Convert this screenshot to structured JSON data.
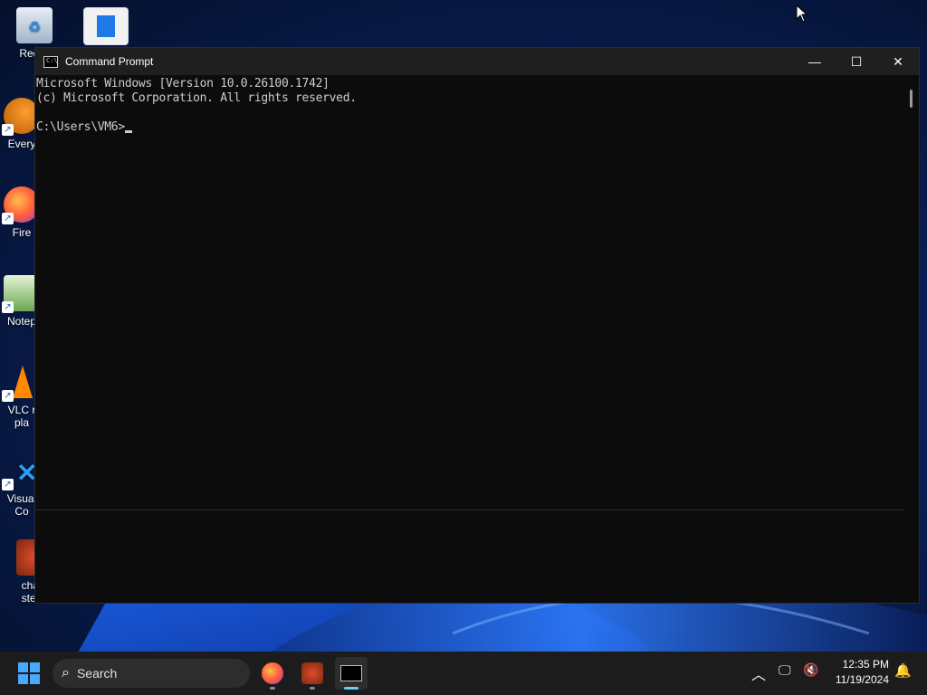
{
  "desktop": {
    "icons": [
      {
        "label": "Recyc",
        "icon": "recycle-bin-icon"
      },
      {
        "label": "",
        "icon": "window-app-icon"
      },
      {
        "label": "Every",
        "icon": "everything-search-icon"
      },
      {
        "label": "Fire",
        "icon": "firefox-icon"
      },
      {
        "label": "Notep",
        "icon": "notepad-icon"
      },
      {
        "label": "VLC r",
        "label2": "pla",
        "icon": "vlc-icon"
      },
      {
        "label": "Visual",
        "label2": "Co",
        "icon": "vscode-icon"
      },
      {
        "label": "charli",
        "label2": "steak",
        "icon": "game-icon"
      }
    ]
  },
  "window": {
    "title": "Command Prompt",
    "minimize": "—",
    "maximize": "☐",
    "close": "✕",
    "console_lines": [
      "Microsoft Windows [Version 10.0.26100.1742]",
      "(c) Microsoft Corporation. All rights reserved.",
      "",
      "C:\\Users\\VM6>"
    ]
  },
  "taskbar": {
    "search_label": "Search",
    "apps": [
      "firefox-icon",
      "game-icon",
      "terminal-icon"
    ],
    "clock_time": "12:35 PM",
    "clock_date": "11/19/2024"
  },
  "colors": {
    "accent": "#60cdff",
    "console_bg": "#0c0c0c",
    "console_text": "#cccccc"
  }
}
